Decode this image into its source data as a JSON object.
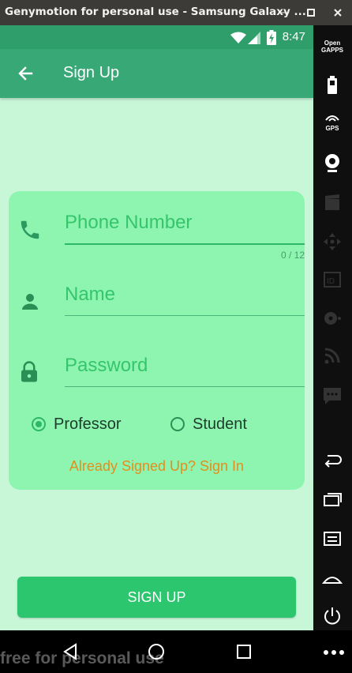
{
  "window": {
    "title": "Genymotion for personal use - Samsung Galaxy ..."
  },
  "statusbar": {
    "time": "8:47",
    "icons": [
      "wifi-icon",
      "signal-icon",
      "battery-charging-icon"
    ]
  },
  "appbar": {
    "title": "Sign Up",
    "back_icon": "arrow-left-icon"
  },
  "form": {
    "phone": {
      "placeholder": "Phone Number",
      "counter": "0 / 12",
      "icon": "phone-icon"
    },
    "name": {
      "placeholder": "Name",
      "icon": "person-icon"
    },
    "password": {
      "placeholder": "Password",
      "icon": "lock-icon"
    },
    "roles": [
      {
        "label": "Professor",
        "selected": true
      },
      {
        "label": "Student",
        "selected": false
      }
    ],
    "signin_link": "Already Signed Up? Sign In"
  },
  "signup_button": "SIGN UP",
  "watermark": "free for personal use",
  "side_panel": {
    "open_gapps_label": "Open GAPPS",
    "gps_label": "GPS",
    "items": [
      "open-gapps-icon",
      "battery-icon",
      "gps-icon",
      "webcam-icon",
      "media-icon",
      "dpad-icon",
      "id-icon",
      "disk-icon",
      "rss-icon",
      "sms-icon",
      "back-icon",
      "recent-apps-icon",
      "menu-icon",
      "home-icon",
      "power-icon"
    ]
  },
  "navbar": {
    "items": [
      "nav-back-icon",
      "nav-home-icon",
      "nav-recents-icon",
      "more-icon"
    ]
  },
  "colors": {
    "accent": "#2eb865",
    "appbar": "#38a877",
    "card": "#8ef5b0",
    "background": "#c8f7d8",
    "link": "#e58d1c"
  }
}
